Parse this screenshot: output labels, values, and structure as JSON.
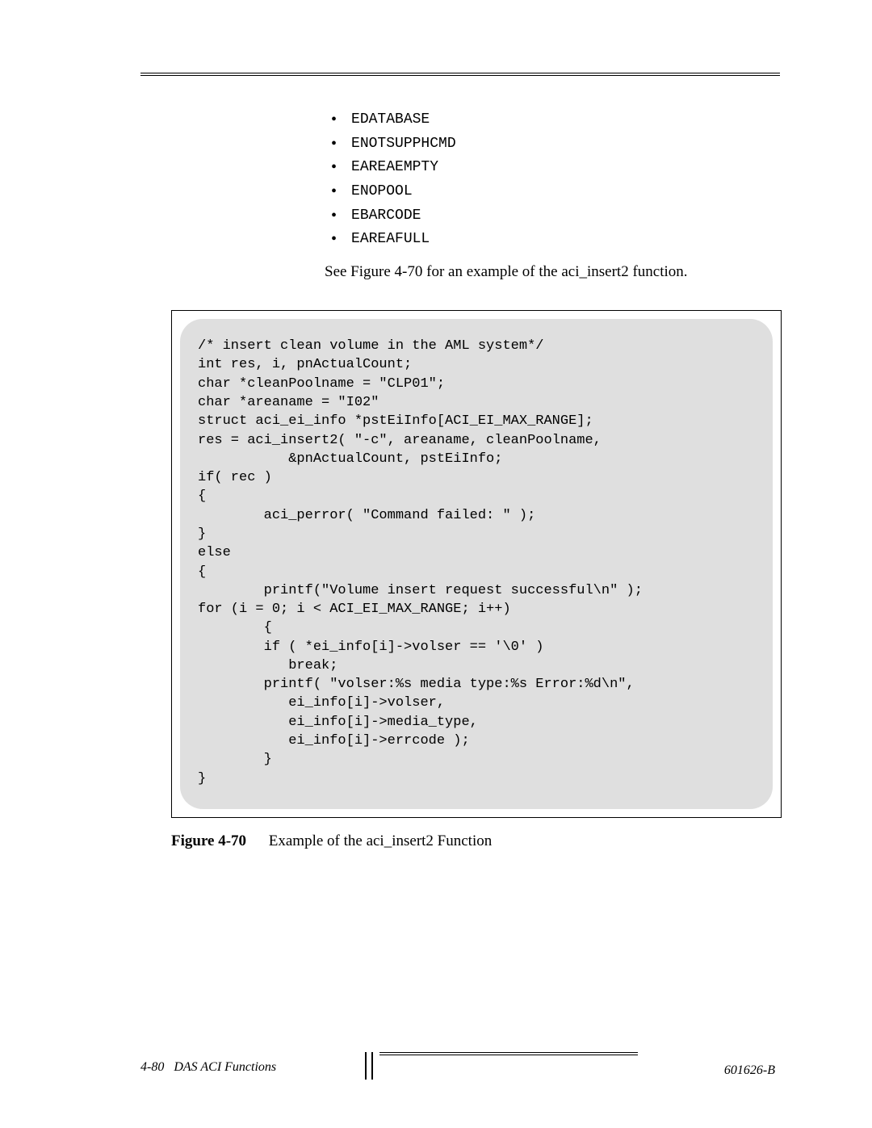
{
  "errors": [
    "EDATABASE",
    "ENOTSUPPHCMD",
    "EAREAEMPTY",
    "ENOPOOL",
    "EBARCODE",
    "EAREAFULL"
  ],
  "see_line": "See Figure 4-70 for an example of the aci_insert2 function.",
  "code": "/* insert clean volume in the AML system*/\nint res, i, pnActualCount;\nchar *cleanPoolname = \"CLP01\";\nchar *areaname = \"I02\"\nstruct aci_ei_info *pstEiInfo[ACI_EI_MAX_RANGE];\nres = aci_insert2( \"-c\", areaname, cleanPoolname,\n           &pnActualCount, pstEiInfo;\nif( rec )\n{\n        aci_perror( \"Command failed: \" );\n}\nelse\n{\n        printf(\"Volume insert request successful\\n\" );\nfor (i = 0; i < ACI_EI_MAX_RANGE; i++)\n        {\n        if ( *ei_info[i]->volser == '\\0' )\n           break;\n        printf( \"volser:%s media type:%s Error:%d\\n\",\n           ei_info[i]->volser,\n           ei_info[i]->media_type,\n           ei_info[i]->errcode );\n        }\n}",
  "figure": {
    "label": "Figure 4-70",
    "caption": "Example of the aci_insert2 Function"
  },
  "footer": {
    "page": "4-80",
    "section": "DAS ACI Functions",
    "docid": "601626-B"
  }
}
